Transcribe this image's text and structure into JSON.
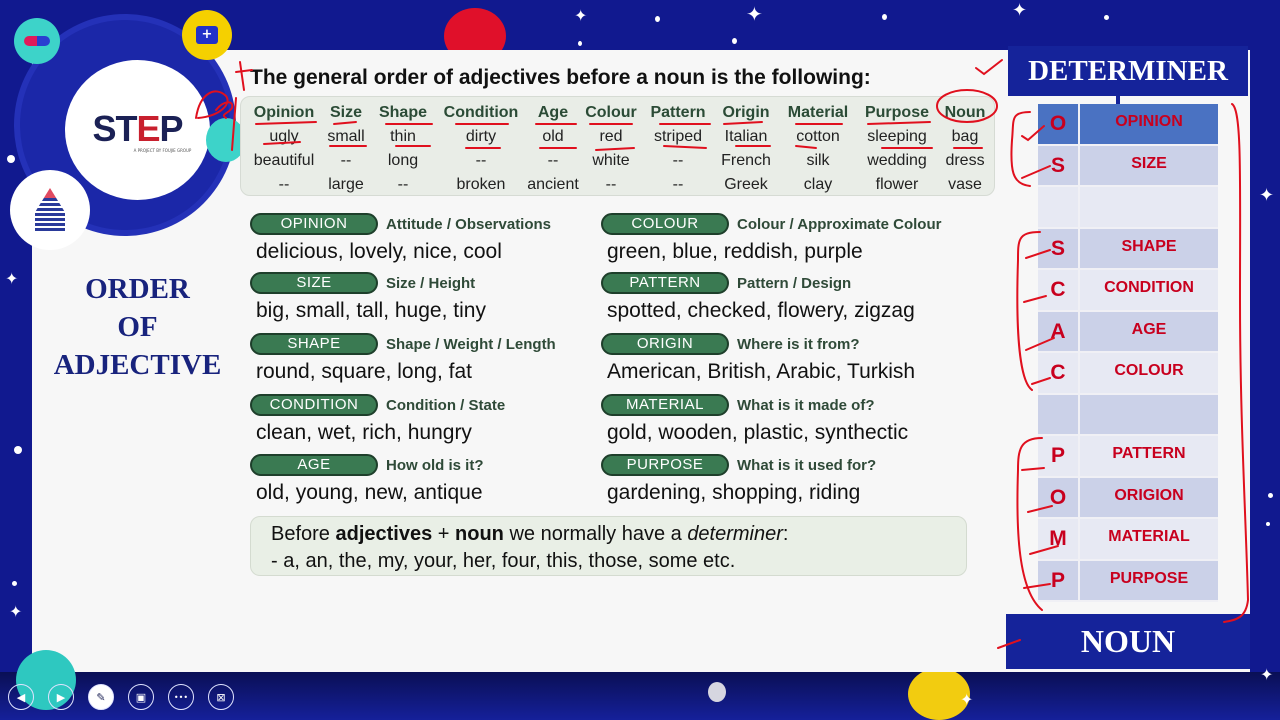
{
  "logo": {
    "brand_prefix": "ST",
    "brand_e": "E",
    "brand_suffix": "P",
    "tagline": "A PROJECT BY FOUJIE GROUP"
  },
  "left_title": {
    "line1": "ORDER",
    "line2": "OF",
    "line3": "ADJECTIVE"
  },
  "heading": "The general order of adjectives before a noun is the following:",
  "adjective_table": {
    "columns": [
      {
        "header": "Opinion",
        "rows": [
          "ugly",
          "beautiful",
          "--"
        ]
      },
      {
        "header": "Size",
        "rows": [
          "small",
          "--",
          "large"
        ]
      },
      {
        "header": "Shape",
        "rows": [
          "thin",
          "long",
          "--"
        ]
      },
      {
        "header": "Condition",
        "rows": [
          "dirty",
          "--",
          "broken"
        ]
      },
      {
        "header": "Age",
        "rows": [
          "old",
          "--",
          "ancient"
        ]
      },
      {
        "header": "Colour",
        "rows": [
          "red",
          "white",
          "--"
        ]
      },
      {
        "header": "Pattern",
        "rows": [
          "striped",
          "--",
          "--"
        ]
      },
      {
        "header": "Origin",
        "rows": [
          "Italian",
          "French",
          "Greek"
        ]
      },
      {
        "header": "Material",
        "rows": [
          "cotton",
          "silk",
          "clay"
        ]
      },
      {
        "header": "Purpose",
        "rows": [
          "sleeping",
          "wedding",
          "flower"
        ]
      },
      {
        "header": "Noun",
        "rows": [
          "bag",
          "dress",
          "vase"
        ]
      }
    ]
  },
  "categories": [
    {
      "name": "OPINION",
      "description": "Attitude / Observations",
      "examples": "delicious, lovely, nice, cool"
    },
    {
      "name": "SIZE",
      "description": "Size / Height",
      "examples": "big, small, tall, huge, tiny"
    },
    {
      "name": "SHAPE",
      "description": "Shape / Weight / Length",
      "examples": "round, square, long, fat"
    },
    {
      "name": "CONDITION",
      "description": "Condition / State",
      "examples": "clean, wet, rich, hungry"
    },
    {
      "name": "AGE",
      "description": "How old is it?",
      "examples": "old, young, new, antique"
    },
    {
      "name": "COLOUR",
      "description": "Colour / Approximate Colour",
      "examples": "green, blue, reddish, purple"
    },
    {
      "name": "PATTERN",
      "description": "Pattern / Design",
      "examples": "spotted, checked, flowery, zigzag"
    },
    {
      "name": "ORIGIN",
      "description": "Where is it from?",
      "examples": "American, British, Arabic, Turkish"
    },
    {
      "name": "MATERIAL",
      "description": "What is it made of?",
      "examples": "gold, wooden, plastic, synthectic"
    },
    {
      "name": "PURPOSE",
      "description": "What is it used for?",
      "examples": "gardening, shopping, riding"
    }
  ],
  "note": {
    "part1": "Before ",
    "bold1": "adjectives",
    "part2": " + ",
    "bold2": "noun",
    "part3": " we normally have a ",
    "italic": "determiner",
    "part4": ":",
    "line2": "- a, an, the, my, your, her, four, this, those, some etc."
  },
  "right_panel": {
    "header": "DETERMINER",
    "rows": [
      {
        "letter": "O",
        "label": "OPINION"
      },
      {
        "letter": "S",
        "label": "SIZE"
      },
      {
        "letter": "",
        "label": ""
      },
      {
        "letter": "S",
        "label": "SHAPE"
      },
      {
        "letter": "C",
        "label": "CONDITION"
      },
      {
        "letter": "A",
        "label": "AGE"
      },
      {
        "letter": "C",
        "label": "COLOUR"
      },
      {
        "letter": "",
        "label": ""
      },
      {
        "letter": "P",
        "label": "PATTERN"
      },
      {
        "letter": "O",
        "label": "ORIGION"
      },
      {
        "letter": "M",
        "label": "MATERIAL"
      },
      {
        "letter": "P",
        "label": "PURPOSE"
      }
    ],
    "footer": "NOUN"
  },
  "annotation": {
    "handwritten_text": "Det",
    "ink_color": "#e0101e"
  },
  "controls": {
    "prev_icon": "◀",
    "next_icon": "▶",
    "pen_icon": "✎",
    "screen_icon": "▣",
    "more_icon": "•••",
    "exit_icon": "⊠"
  },
  "colors": {
    "background": "#11198f",
    "panel_blue": "#15239a",
    "pill_green": "#3a7a52",
    "red_text": "#c8001e"
  }
}
